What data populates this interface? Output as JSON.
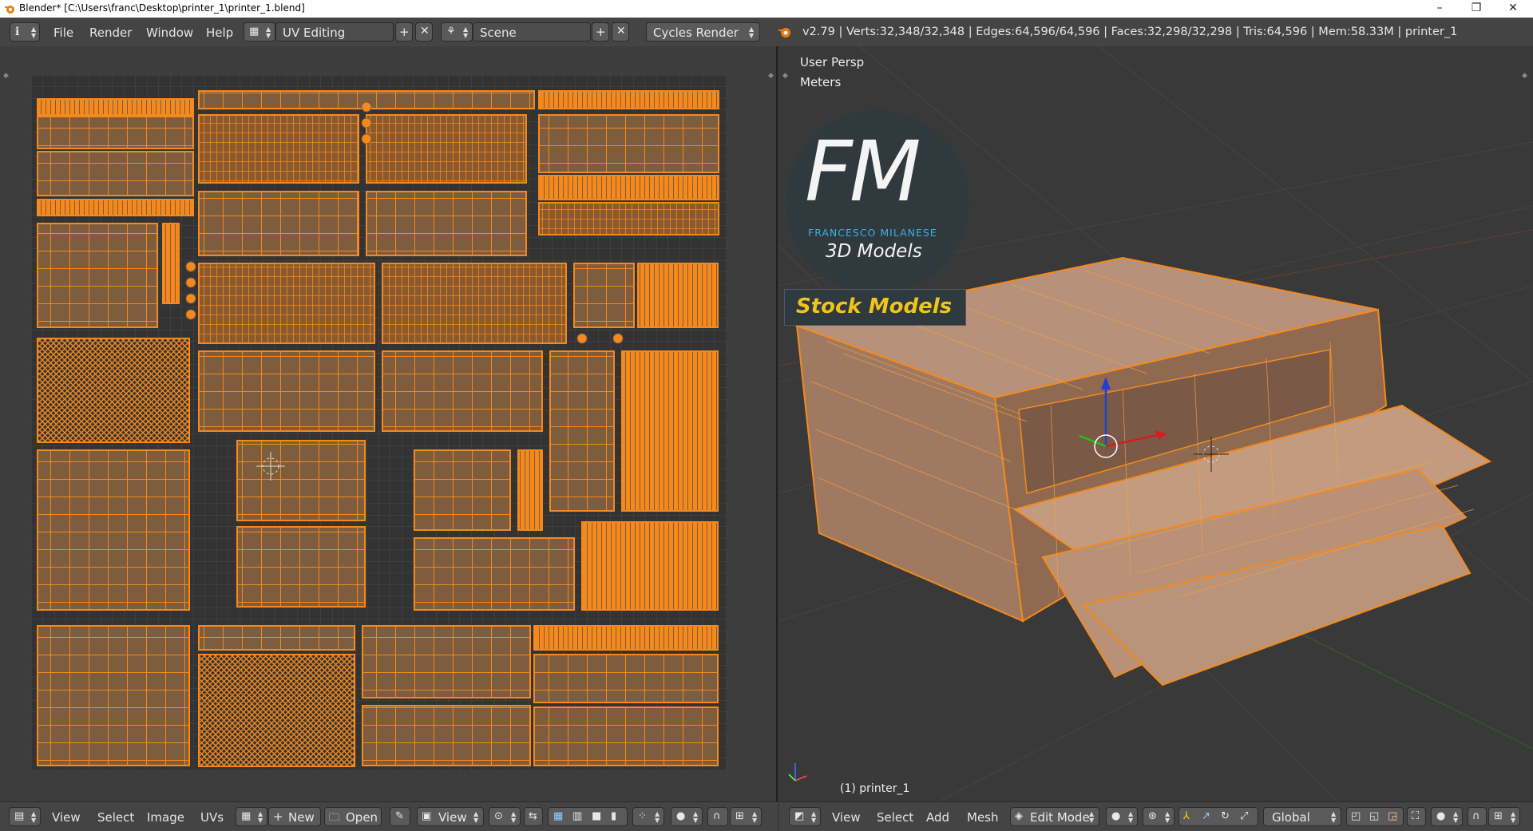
{
  "window": {
    "title": "Blender* [C:\\Users\\franc\\Desktop\\printer_1\\printer_1.blend]",
    "controls": {
      "minimize": "–",
      "restore": "❐",
      "close": "✕"
    }
  },
  "header": {
    "menus": [
      "File",
      "Render",
      "Window",
      "Help"
    ],
    "layout": "UV Editing",
    "scene": "Scene",
    "engine": "Cycles Render",
    "stats": "v2.79 | Verts:32,348/32,348 | Edges:64,596/64,596 | Faces:32,298/32,298 | Tris:64,596 | Mem:58.33M | printer_1"
  },
  "viewport": {
    "view_name": "User Persp",
    "units": "Meters",
    "object_label": "(1) printer_1"
  },
  "logo": {
    "letters": "FM",
    "name": "FRANCESCO MILANESE",
    "tagline": "3D Models",
    "banner": "Stock Models"
  },
  "uv_footer": {
    "menus": [
      "View",
      "Select",
      "Image",
      "UVs"
    ],
    "new_label": "New",
    "open_label": "Open",
    "view_label": "View"
  },
  "viewport_footer": {
    "menus": [
      "View",
      "Select",
      "Add",
      "Mesh"
    ],
    "mode": "Edit Mode",
    "orientation": "Global"
  },
  "colors": {
    "accent": "#f5891c",
    "face_fill": "#7e5c3e",
    "header_bg": "#444444",
    "editor_bg": "#3d3d3d",
    "logo_cyan": "#3fb6e8",
    "banner_text": "#f0c419"
  }
}
